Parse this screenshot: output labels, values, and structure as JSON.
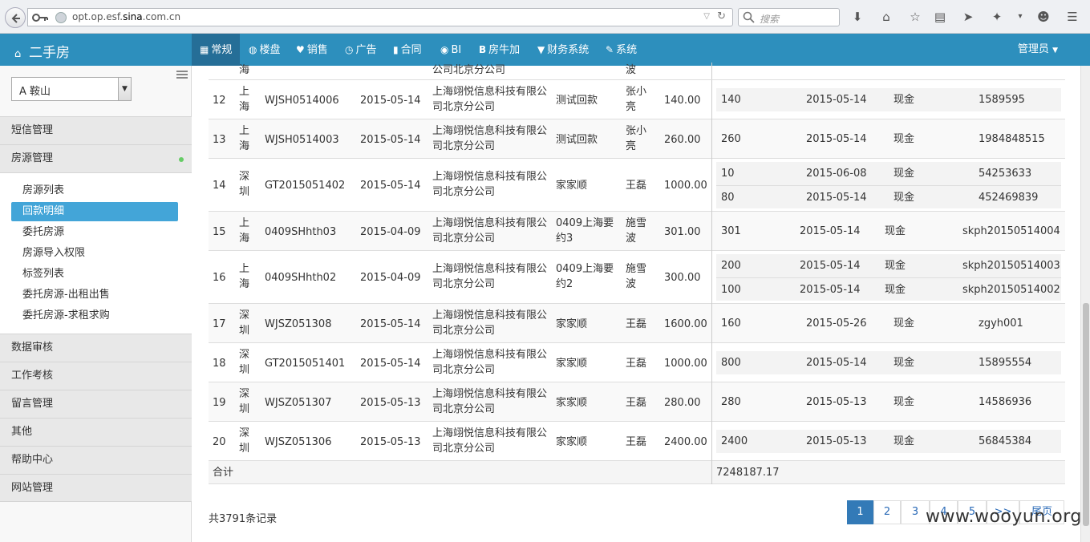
{
  "browser": {
    "url_domain": "opt.op.esf.",
    "url_bold": "sina",
    "url_rest": ".com.cn",
    "search_placeholder": "搜索"
  },
  "navbar": {
    "brand": "二手房",
    "items": [
      {
        "icon": "grid-icon",
        "label": "常规",
        "active": true
      },
      {
        "icon": "globe-icon",
        "label": "楼盘"
      },
      {
        "icon": "heart-icon",
        "label": "销售"
      },
      {
        "icon": "clock-icon",
        "label": "广告"
      },
      {
        "icon": "file-icon",
        "label": "合同"
      },
      {
        "icon": "eye-icon",
        "label": "BI"
      },
      {
        "icon": "b-icon",
        "label": "房牛加"
      },
      {
        "icon": "filter-icon",
        "label": "财务系统"
      },
      {
        "icon": "wrench-icon",
        "label": "系统"
      }
    ],
    "admin": "管理员"
  },
  "sidebar": {
    "city": "A 鞍山",
    "sections": [
      {
        "label": "短信管理"
      },
      {
        "label": "房源管理",
        "open": true
      },
      {
        "label": "数据审核"
      },
      {
        "label": "工作考核"
      },
      {
        "label": "留言管理"
      },
      {
        "label": "其他"
      },
      {
        "label": "帮助中心"
      },
      {
        "label": "网站管理"
      }
    ],
    "sub_items": [
      {
        "label": "房源列表"
      },
      {
        "label": "回款明细",
        "active": true
      },
      {
        "label": "委托房源"
      },
      {
        "label": "房源导入权限"
      },
      {
        "label": "标签列表"
      },
      {
        "label": "委托房源-出租出售"
      },
      {
        "label": "委托房源-求租求购"
      }
    ]
  },
  "table": {
    "partial_top": {
      "city": "海",
      "company": "公司北京分公司",
      "person": "波"
    },
    "rows": [
      {
        "no": "12",
        "city": "上海",
        "contract": "WJSH0514006",
        "date": "2015-05-14",
        "company": "上海翊悦信息科技有限公司北京分公司",
        "project": "测试回款",
        "person": "张小亮",
        "amount": "140.00",
        "payments": [
          {
            "amount": "140",
            "date": "2015-05-14",
            "method": "现金",
            "receipt": "1589595"
          }
        ]
      },
      {
        "no": "13",
        "city": "上海",
        "contract": "WJSH0514003",
        "date": "2015-05-14",
        "company": "上海翊悦信息科技有限公司北京分公司",
        "project": "测试回款",
        "person": "张小亮",
        "amount": "260.00",
        "payments": [
          {
            "amount": "260",
            "date": "2015-05-14",
            "method": "现金",
            "receipt": "1984848515"
          }
        ]
      },
      {
        "no": "14",
        "city": "深圳",
        "contract": "GT2015051402",
        "date": "2015-05-14",
        "company": "上海翊悦信息科技有限公司北京分公司",
        "project": "家家顺",
        "person": "王磊",
        "amount": "1000.00",
        "payments": [
          {
            "amount": "10",
            "date": "2015-06-08",
            "method": "现金",
            "receipt": "54253633"
          },
          {
            "amount": "80",
            "date": "2015-05-14",
            "method": "现金",
            "receipt": "452469839"
          }
        ]
      },
      {
        "no": "15",
        "city": "上海",
        "contract": "0409SHhth03",
        "date": "2015-04-09",
        "company": "上海翊悦信息科技有限公司北京分公司",
        "project": "0409上海要约3",
        "person": "施雪波",
        "amount": "301.00",
        "payments": [
          {
            "amount": "301",
            "date": "2015-05-14",
            "method": "现金",
            "receipt": "skph20150514004"
          }
        ]
      },
      {
        "no": "16",
        "city": "上海",
        "contract": "0409SHhth02",
        "date": "2015-04-09",
        "company": "上海翊悦信息科技有限公司北京分公司",
        "project": "0409上海要约2",
        "person": "施雪波",
        "amount": "300.00",
        "payments": [
          {
            "amount": "200",
            "date": "2015-05-14",
            "method": "现金",
            "receipt": "skph20150514003"
          },
          {
            "amount": "100",
            "date": "2015-05-14",
            "method": "现金",
            "receipt": "skph20150514002"
          }
        ]
      },
      {
        "no": "17",
        "city": "深圳",
        "contract": "WJSZ051308",
        "date": "2015-05-14",
        "company": "上海翊悦信息科技有限公司北京分公司",
        "project": "家家顺",
        "person": "王磊",
        "amount": "1600.00",
        "payments": [
          {
            "amount": "160",
            "date": "2015-05-26",
            "method": "现金",
            "receipt": "zgyh001"
          }
        ]
      },
      {
        "no": "18",
        "city": "深圳",
        "contract": "GT2015051401",
        "date": "2015-05-14",
        "company": "上海翊悦信息科技有限公司北京分公司",
        "project": "家家顺",
        "person": "王磊",
        "amount": "1000.00",
        "payments": [
          {
            "amount": "800",
            "date": "2015-05-14",
            "method": "现金",
            "receipt": "15895554"
          }
        ]
      },
      {
        "no": "19",
        "city": "深圳",
        "contract": "WJSZ051307",
        "date": "2015-05-13",
        "company": "上海翊悦信息科技有限公司北京分公司",
        "project": "家家顺",
        "person": "王磊",
        "amount": "280.00",
        "payments": [
          {
            "amount": "280",
            "date": "2015-05-13",
            "method": "现金",
            "receipt": "14586936"
          }
        ]
      },
      {
        "no": "20",
        "city": "深圳",
        "contract": "WJSZ051306",
        "date": "2015-05-13",
        "company": "上海翊悦信息科技有限公司北京分公司",
        "project": "家家顺",
        "person": "王磊",
        "amount": "2400.00",
        "payments": [
          {
            "amount": "2400",
            "date": "2015-05-13",
            "method": "现金",
            "receipt": "56845384"
          }
        ]
      }
    ],
    "total_label": "合计",
    "total_value": "7248187.17"
  },
  "footer": {
    "record_count": "共3791条记录",
    "pages": [
      "1",
      "2",
      "3",
      "4",
      "5",
      ">>",
      "尾页"
    ],
    "current_page": "1"
  },
  "watermark": "www.wooyun.org"
}
